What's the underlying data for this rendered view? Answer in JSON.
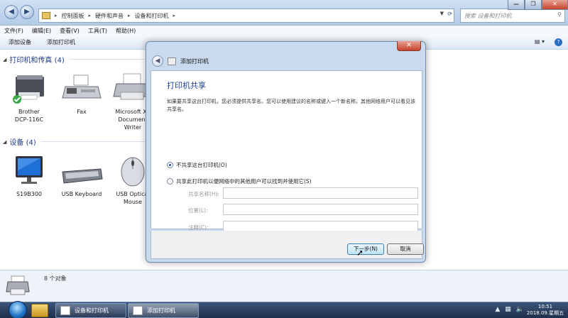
{
  "explorer": {
    "breadcrumb": [
      "控制面板",
      "硬件和声音",
      "设备和打印机"
    ],
    "search_placeholder": "搜索 设备和打印机",
    "window_controls": {
      "minimize": "—",
      "maximize": "❐",
      "close": "✕"
    },
    "menu": [
      "文件(F)",
      "编辑(E)",
      "查看(V)",
      "工具(T)",
      "帮助(H)"
    ],
    "commands": [
      "添加设备",
      "添加打印机"
    ],
    "printers_group": {
      "title": "打印机和传真 (4)"
    },
    "printers": [
      {
        "line1": "Brother",
        "line2": "DCP-116C",
        "line3": ""
      },
      {
        "line1": "Fax",
        "line2": "",
        "line3": ""
      },
      {
        "line1": "Microsoft XP",
        "line2": "Document",
        "line3": "Writer"
      }
    ],
    "devices_group": {
      "title": "设备 (4)"
    },
    "devices": [
      {
        "line1": "S19B300",
        "line2": ""
      },
      {
        "line1": "USB Keyboard",
        "line2": ""
      },
      {
        "line1": "USB Optical",
        "line2": "Mouse"
      }
    ],
    "status": {
      "count": "8 个对象"
    }
  },
  "dialog": {
    "close": "✕",
    "title": "添加打印机",
    "heading": "打印机共享",
    "description": "如果要共享这台打印机，您必须提供共享名。您可以使用建议的名称或键入一个新名称。其他网络用户可以看见该共享名。",
    "option_noshare": "不共享这台打印机(O)",
    "option_share": "共享此打印机以便网络中的其他用户可以找到并使用它(S)",
    "label_share_name": "共享名称(H):",
    "label_location": "位置(L):",
    "label_comment": "注释(C):",
    "btn_next": "下一步(N)",
    "btn_cancel": "取消",
    "selected_option": "noshare"
  },
  "taskbar": {
    "task_printers": "设备和打印机",
    "task_add": "添加打印机",
    "clock_time": "10:51",
    "clock_date": "2018.09.星期五"
  },
  "colors": {
    "title_bar": "#b4cbe6",
    "group_header": "#1e3b8a",
    "dialog_heading": "#1a3d8f",
    "close_button": "#c4422d",
    "taskbar": "#1e2f4a"
  }
}
